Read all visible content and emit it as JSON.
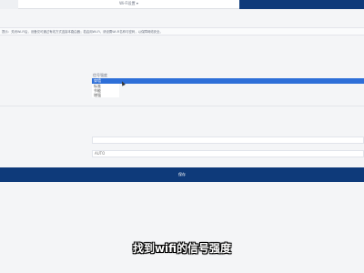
{
  "header": {
    "tab_label": "Wi-Fi设置 ▾"
  },
  "notice": {
    "text": "提示：关闭Wi-Fi后，设备仅可通过有线方式连接本路由器；若启用Wi-Fi，请设置Wi-Fi名称与密码，以保障网络安全。"
  },
  "form": {
    "signal_strength": {
      "label": "信号强度",
      "selected": "穿墙",
      "options": [
        "穿墙",
        "标准",
        "节能",
        "增强"
      ]
    },
    "channel": {
      "label": "信道",
      "value": "AUTO"
    },
    "save_label": "保存"
  },
  "subtitle": "找到wifi的信号强度",
  "colors": {
    "primary_dark": "#0e3a7a",
    "select_highlight": "#2e6fd8"
  }
}
